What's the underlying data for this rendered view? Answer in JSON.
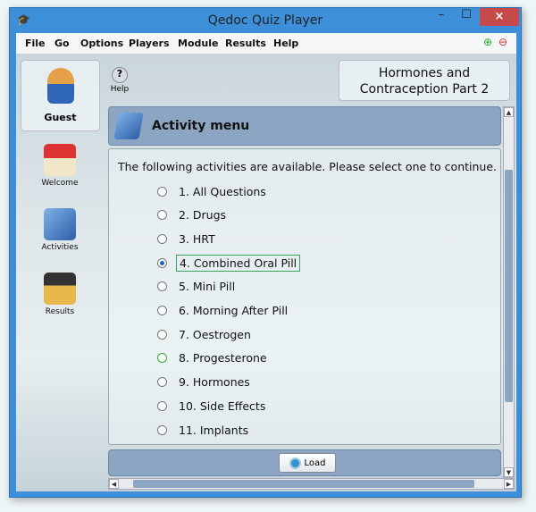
{
  "window": {
    "title": "Qedoc Quiz Player",
    "close": "×",
    "minimize": "–",
    "maximize": "☐"
  },
  "menu": [
    "File",
    "Go",
    "Options",
    "Players",
    "Module",
    "Results",
    "Help"
  ],
  "sidebar": {
    "user": "Guest",
    "items": [
      {
        "label": "Welcome"
      },
      {
        "label": "Activities"
      },
      {
        "label": "Results"
      }
    ]
  },
  "help_label": "Help",
  "module_title": "Hormones and Contraception Part 2",
  "activity_header": "Activity menu",
  "intro": "The following activities are available. Please select one to continue.",
  "activities": [
    {
      "label": "1.   All Questions"
    },
    {
      "label": "2.   Drugs"
    },
    {
      "label": "3.   HRT"
    },
    {
      "label": "4.   Combined Oral Pill",
      "selected": true
    },
    {
      "label": "5.   Mini Pill"
    },
    {
      "label": "6.   Morning After Pill"
    },
    {
      "label": "7.   Oestrogen"
    },
    {
      "label": "8.   Progesterone"
    },
    {
      "label": "9.   Hormones"
    },
    {
      "label": "10. Side Effects"
    },
    {
      "label": "11. Implants"
    }
  ],
  "load_label": "Load"
}
